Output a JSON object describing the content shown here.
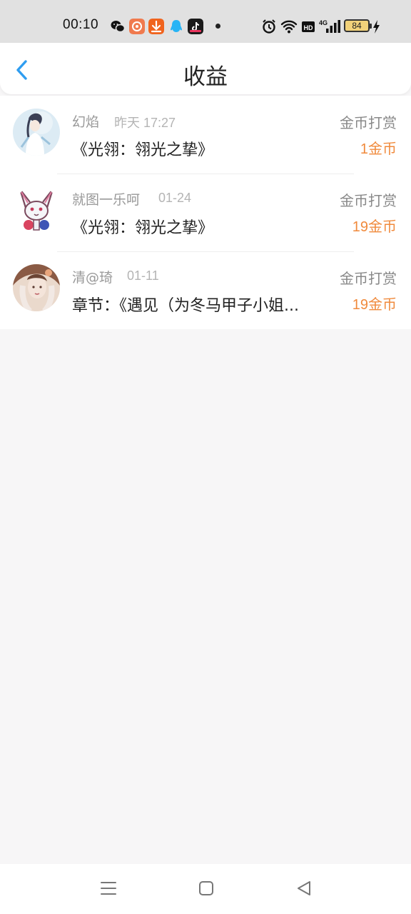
{
  "status_bar": {
    "time": "00:10",
    "battery": "84",
    "icons": [
      "wechat-icon",
      "orange-app-icon",
      "download-icon",
      "qq-icon",
      "tiktok-icon",
      "notification-dot-icon",
      "alarm-icon",
      "wifi-icon",
      "hd-icon",
      "signal-4g-icon",
      "battery-icon",
      "charging-icon"
    ]
  },
  "header": {
    "title": "收益",
    "back_icon": "chevron-left-icon",
    "accent": "#2f9df0"
  },
  "records": [
    {
      "user": "幻焰",
      "date": "昨天 17:27",
      "work": "《光翎：翎光之挚》",
      "type": "金币打赏",
      "amount": "1金币"
    },
    {
      "user": "就图一乐呵",
      "date": "01-24",
      "work": "《光翎：翎光之挚》",
      "type": "金币打赏",
      "amount": "19金币"
    },
    {
      "user": "清@琦",
      "date": "01-11",
      "work": "章节：《遇见（为冬马甲子小姐...",
      "type": "金币打赏",
      "amount": "19金币"
    }
  ],
  "colors": {
    "amount": "#f08a3c",
    "background": "#f7f6f7"
  },
  "navbar": {
    "icons": [
      "menu-icon",
      "home-square-icon",
      "back-triangle-icon"
    ]
  }
}
